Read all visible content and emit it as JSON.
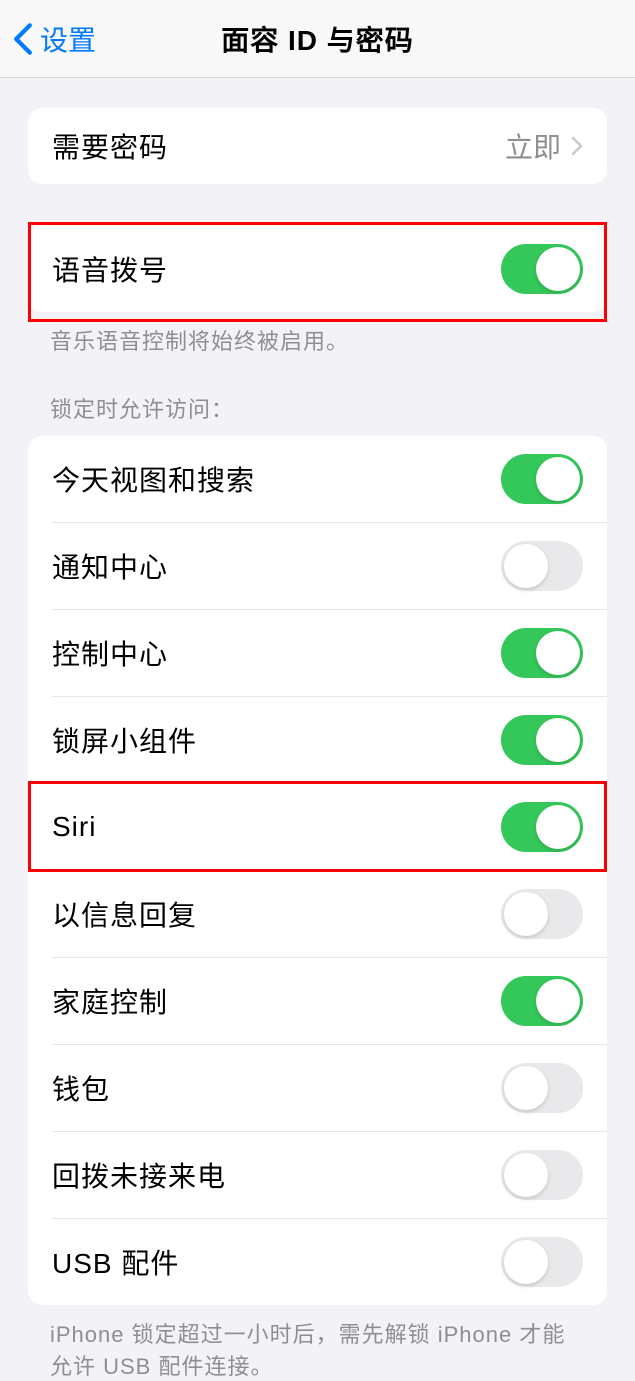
{
  "nav": {
    "back_label": "设置",
    "title": "面容 ID 与密码"
  },
  "require_passcode": {
    "label": "需要密码",
    "value": "立即"
  },
  "voice_dial": {
    "label": "语音拨号",
    "on": true,
    "footer": "音乐语音控制将始终被启用。"
  },
  "lock_access": {
    "header": "锁定时允许访问：",
    "items": [
      {
        "label": "今天视图和搜索",
        "on": true
      },
      {
        "label": "通知中心",
        "on": false
      },
      {
        "label": "控制中心",
        "on": true
      },
      {
        "label": "锁屏小组件",
        "on": true
      },
      {
        "label": "Siri",
        "on": true
      },
      {
        "label": "以信息回复",
        "on": false
      },
      {
        "label": "家庭控制",
        "on": true
      },
      {
        "label": "钱包",
        "on": false
      },
      {
        "label": "回拨未接来电",
        "on": false
      },
      {
        "label": "USB 配件",
        "on": false
      }
    ],
    "footer": "iPhone 锁定超过一小时后，需先解锁 iPhone 才能允许 USB 配件连接。"
  }
}
